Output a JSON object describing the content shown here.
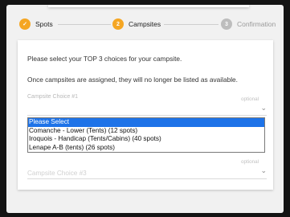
{
  "stepper": {
    "steps": [
      {
        "label": "Spots",
        "marker": "✓",
        "state": "complete"
      },
      {
        "label": "Campsites",
        "marker": "2",
        "state": "active"
      },
      {
        "label": "Confirmation",
        "marker": "3",
        "state": "inactive"
      }
    ]
  },
  "card": {
    "instruction": "Please select your TOP 3 choices for your campsite.",
    "notice": "Once campsites are assigned, they will no longer be listed as available.",
    "choice1": {
      "label": "Campsite Choice #1",
      "optional": "optional"
    },
    "dropdown_options": [
      "Please Select",
      "Comanche - Lower (Tents) (12 spots)",
      "Iroquois - Handicap (Tents/Cabins) (40 spots)",
      "Lenape A-B (tents) (26 spots)"
    ],
    "choice3": {
      "label": "Campsite Choice #3",
      "optional": "optional"
    }
  },
  "colors": {
    "accent": "#f5a623",
    "selected_option": "#1e73e8",
    "inactive_step": "#bdbdbd"
  }
}
